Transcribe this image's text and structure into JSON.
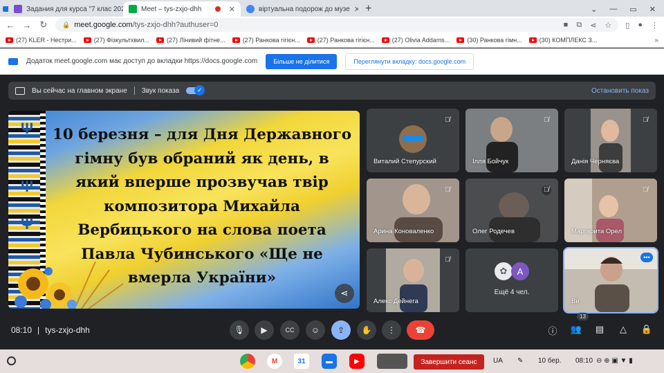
{
  "tabs": [
    {
      "title": "Задания для курса \"7 клас 202",
      "favicon_color": "#7b4fd0",
      "active": false
    },
    {
      "title": "Meet – tys-zxjo-dhh",
      "favicon_color": "#00ac47",
      "active": true
    },
    {
      "title": "віртуальна подорож до музе",
      "favicon_color": "#4285f4",
      "active": false
    }
  ],
  "toolbar": {
    "url_domain": "meet.google.com",
    "url_path": "/tys-zxjo-dhh?authuser=0"
  },
  "bookmarks": [
    "(27) KLER - Нестри...",
    "(27) Фізкультхвил...",
    "(27) Лінивий фітне...",
    "(27) Ранкова гігієн...",
    "(27) Ранкова гігієн...",
    "(27) Olivia Addams...",
    "(30) Ранкова гімн...",
    "(30) КОМПЛЕКС З..."
  ],
  "infobar": {
    "message": "Додаток meet.google.com має доступ до вкладки https://docs.google.com",
    "primary_button": "Більше не ділитися",
    "secondary_button": "Переглянути вкладку: docs.google.com"
  },
  "presentation_bar": {
    "status": "Вы сейчас на главном экране",
    "sound_label": "Звук показа",
    "stop_label": "Остановить показ"
  },
  "slide": {
    "lines": [
      "10 березня – для Дня Державного",
      "гімну був обраний як день, в",
      "який вперше прозвучав твір",
      "композитора Михайла",
      "Вербицького на слова поета",
      "Павла Чубинського «Ще не",
      "вмерла України»"
    ]
  },
  "participants": [
    {
      "name": "Виталий Степурский",
      "bg": "#3c4043"
    },
    {
      "name": "Ілля Бойчук",
      "bg": "#6b6f72"
    },
    {
      "name": "Данія Черняєва",
      "bg": "#8c8a86"
    },
    {
      "name": "Арина Коноваленко",
      "bg": "#9a8e86"
    },
    {
      "name": "Олег Родечев",
      "bg": "#4a4c4e"
    },
    {
      "name": "Маргарита Орел",
      "bg": "#a89688"
    },
    {
      "name": "Алекс Дейнега",
      "bg": "#8f8a80"
    },
    {
      "name": "Ещё 4 чел.",
      "avatar_letter": "A",
      "avatar_color": "#7e57c2"
    },
    {
      "name": "Ви",
      "bg": "#b8b0a4"
    }
  ],
  "meeting": {
    "time": "08:10",
    "separator": "|",
    "code": "tys-zxjo-dhh",
    "participant_count": "13"
  },
  "shelf": {
    "end_session": "Завершити сеанс",
    "lang": "UA",
    "date": "10 бер.",
    "time": "08:10"
  }
}
